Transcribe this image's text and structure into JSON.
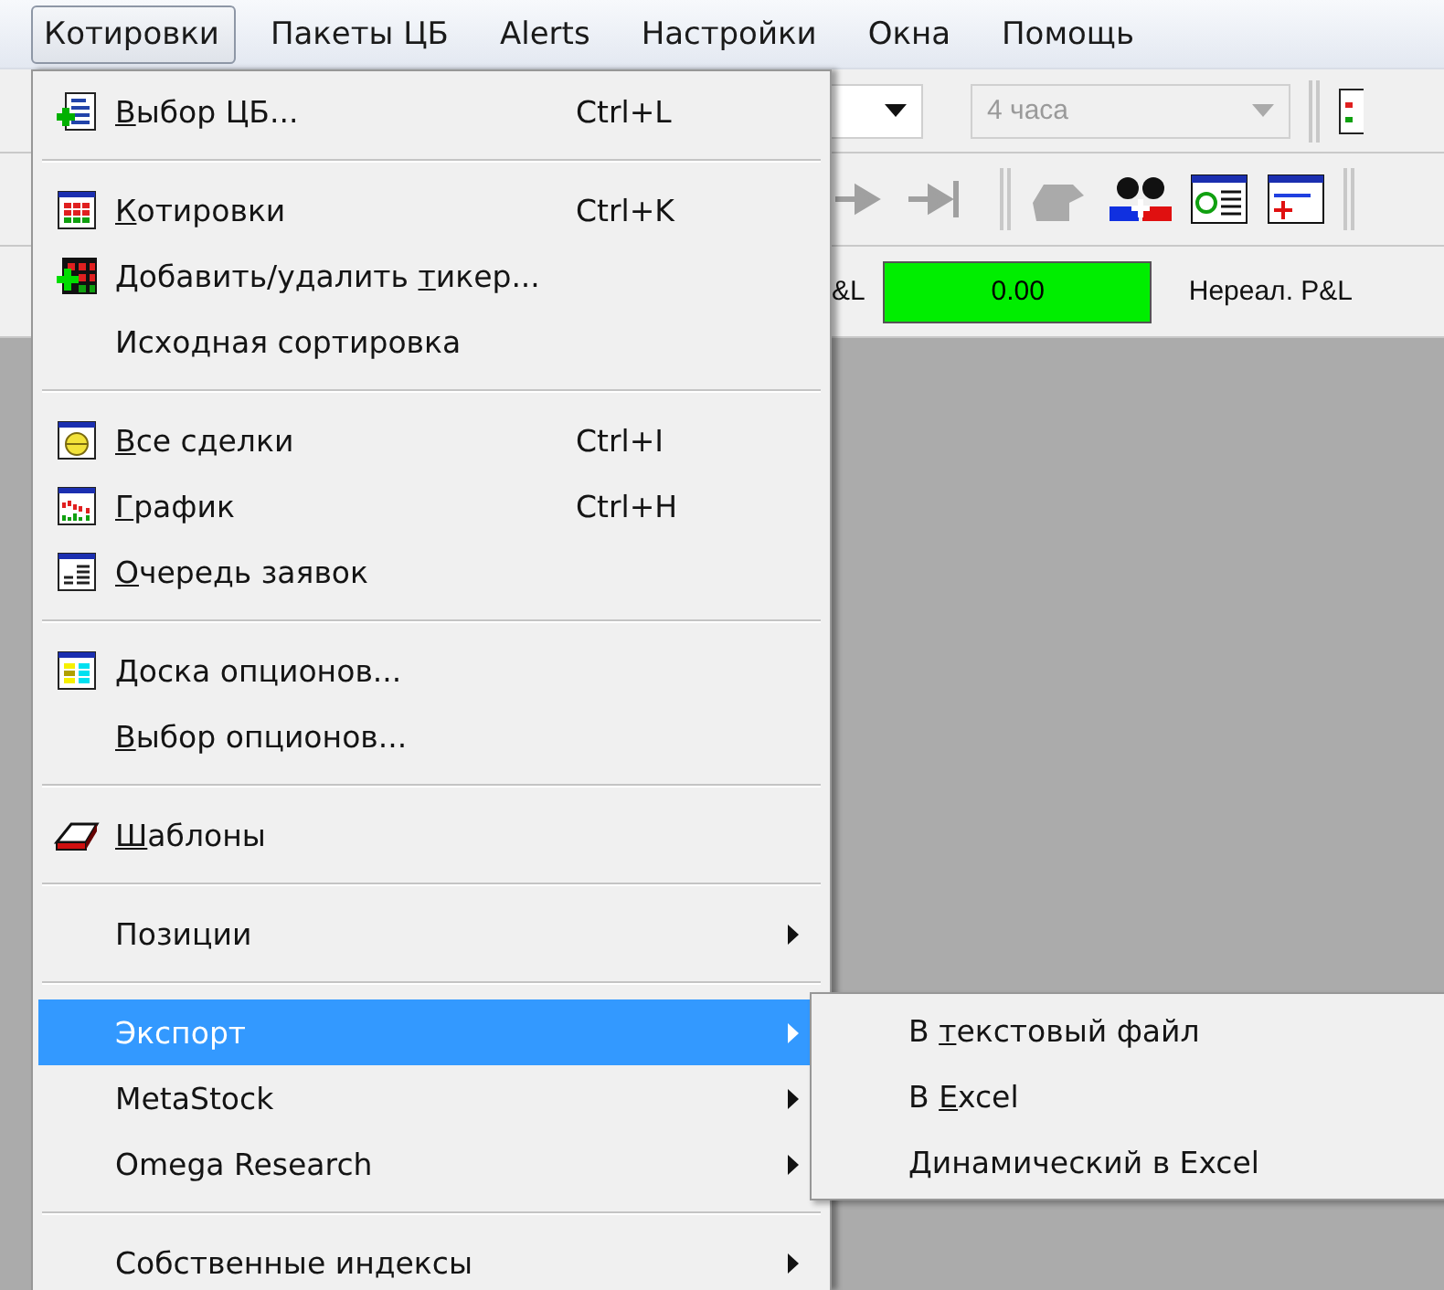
{
  "menubar": [
    {
      "label": "Котировки",
      "selected": true
    },
    {
      "label": "Пакеты ЦБ",
      "selected": false
    },
    {
      "label": "Alerts",
      "selected": false
    },
    {
      "label": "Настройки",
      "selected": false
    },
    {
      "label": "Окна",
      "selected": false
    },
    {
      "label": "Помощь",
      "selected": false
    }
  ],
  "toolbar": {
    "period": {
      "value": "4 часа",
      "disabled": true
    }
  },
  "pnl": {
    "label": "&L",
    "value": "0.00",
    "unrealized_label": "Нереал. P&L"
  },
  "menu": [
    {
      "kind": "item",
      "mnemonic": "В",
      "label_rest": "ыбор ЦБ...",
      "shortcut": "Ctrl+L",
      "has_submenu": false,
      "selected": false
    },
    {
      "kind": "separator"
    },
    {
      "kind": "item",
      "mnemonic": "К",
      "label_rest": "отировки",
      "shortcut": "Ctrl+K",
      "has_submenu": false,
      "selected": false
    },
    {
      "kind": "item",
      "label_start": "Добавить/удалить ",
      "mnemonic": "т",
      "label_rest": "икер...",
      "has_submenu": false,
      "selected": false
    },
    {
      "kind": "item",
      "label_rest": "Исходная сортировка",
      "has_submenu": false,
      "selected": false
    },
    {
      "kind": "separator"
    },
    {
      "kind": "item",
      "mnemonic": "В",
      "label_rest": "се сделки",
      "shortcut": "Ctrl+I",
      "has_submenu": false,
      "selected": false
    },
    {
      "kind": "item",
      "mnemonic": "Г",
      "label_rest": "рафик",
      "shortcut": "Ctrl+H",
      "has_submenu": false,
      "selected": false
    },
    {
      "kind": "item",
      "mnemonic": "О",
      "label_rest": "чередь заявок",
      "has_submenu": false,
      "selected": false
    },
    {
      "kind": "separator"
    },
    {
      "kind": "item",
      "mnemonic": "Д",
      "label_rest": "оска опционов...",
      "has_submenu": false,
      "selected": false
    },
    {
      "kind": "item",
      "mnemonic": "В",
      "label_rest": "ыбор опционов...",
      "has_submenu": false,
      "selected": false
    },
    {
      "kind": "separator"
    },
    {
      "kind": "item",
      "mnemonic": "Ш",
      "label_rest": "аблоны",
      "has_submenu": false,
      "selected": false
    },
    {
      "kind": "separator"
    },
    {
      "kind": "item",
      "label_rest": "Позиции",
      "has_submenu": true,
      "selected": false
    },
    {
      "kind": "separator"
    },
    {
      "kind": "item",
      "label_rest": "Экспорт",
      "has_submenu": true,
      "selected": true
    },
    {
      "kind": "item",
      "label_rest": "MetaStock",
      "has_submenu": true,
      "selected": false
    },
    {
      "kind": "item",
      "label_rest": "Omega Research",
      "has_submenu": true,
      "selected": false
    },
    {
      "kind": "separator"
    },
    {
      "kind": "item",
      "label_rest": "Собственные индексы",
      "has_submenu": true,
      "selected": false
    }
  ],
  "submenu": [
    {
      "label_start": "В ",
      "mnemonic": "т",
      "label_rest": "екстовый файл"
    },
    {
      "label_start": "В ",
      "mnemonic": "E",
      "label_rest": "xcel"
    },
    {
      "mnemonic": "Д",
      "label_rest": "инамический в Excel"
    }
  ]
}
